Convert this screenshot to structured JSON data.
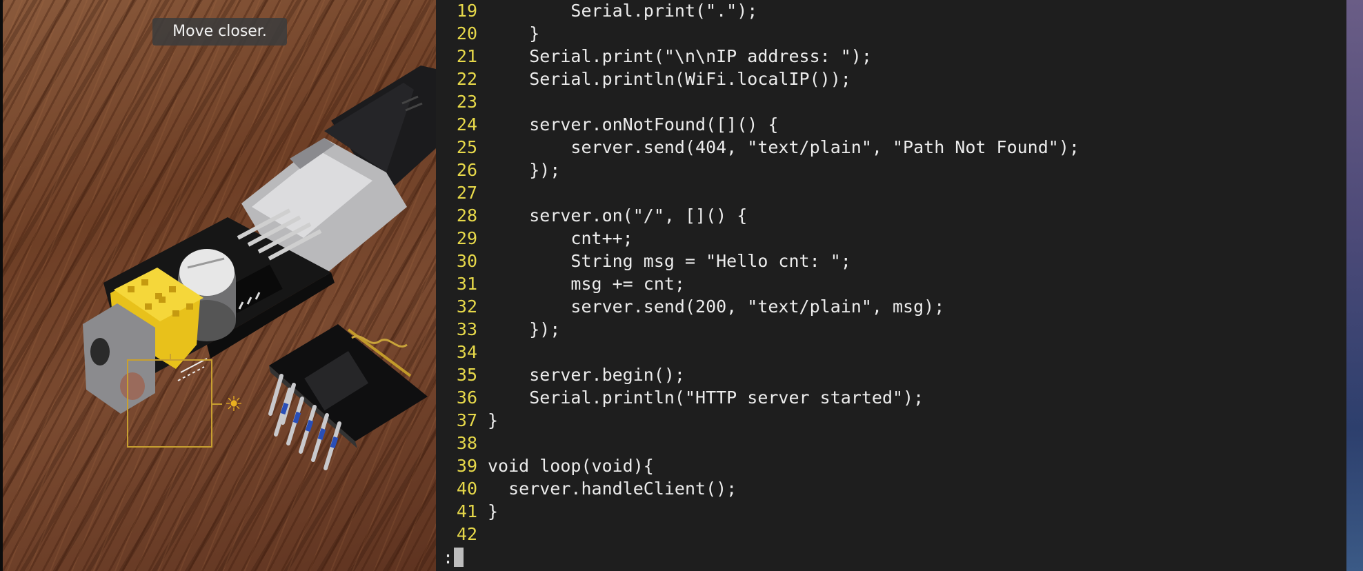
{
  "camera": {
    "toast": "Move closer.",
    "exposure_icon": "sun-exposure-icon"
  },
  "editor": {
    "lines": [
      {
        "num": "19",
        "text": "        Serial.print(\".\");"
      },
      {
        "num": "20",
        "text": "    }"
      },
      {
        "num": "21",
        "text": "    Serial.print(\"\\n\\nIP address: \");"
      },
      {
        "num": "22",
        "text": "    Serial.println(WiFi.localIP());"
      },
      {
        "num": "23",
        "text": ""
      },
      {
        "num": "24",
        "text": "    server.onNotFound([]() {"
      },
      {
        "num": "25",
        "text": "        server.send(404, \"text/plain\", \"Path Not Found\");"
      },
      {
        "num": "26",
        "text": "    });"
      },
      {
        "num": "27",
        "text": ""
      },
      {
        "num": "28",
        "text": "    server.on(\"/\", []() {"
      },
      {
        "num": "29",
        "text": "        cnt++;"
      },
      {
        "num": "30",
        "text": "        String msg = \"Hello cnt: \";"
      },
      {
        "num": "31",
        "text": "        msg += cnt;"
      },
      {
        "num": "32",
        "text": "        server.send(200, \"text/plain\", msg);"
      },
      {
        "num": "33",
        "text": "    });"
      },
      {
        "num": "34",
        "text": ""
      },
      {
        "num": "35",
        "text": "    server.begin();"
      },
      {
        "num": "36",
        "text": "    Serial.println(\"HTTP server started\");"
      },
      {
        "num": "37",
        "text": "}"
      },
      {
        "num": "38",
        "text": ""
      },
      {
        "num": "39",
        "text": "void loop(void){"
      },
      {
        "num": "40",
        "text": "  server.handleClient();"
      },
      {
        "num": "41",
        "text": "}"
      },
      {
        "num": "42",
        "text": ""
      }
    ],
    "prompt": ":",
    "colors": {
      "background": "#1e1e1e",
      "line_number": "#e6d84a",
      "code_text": "#ececec"
    }
  }
}
